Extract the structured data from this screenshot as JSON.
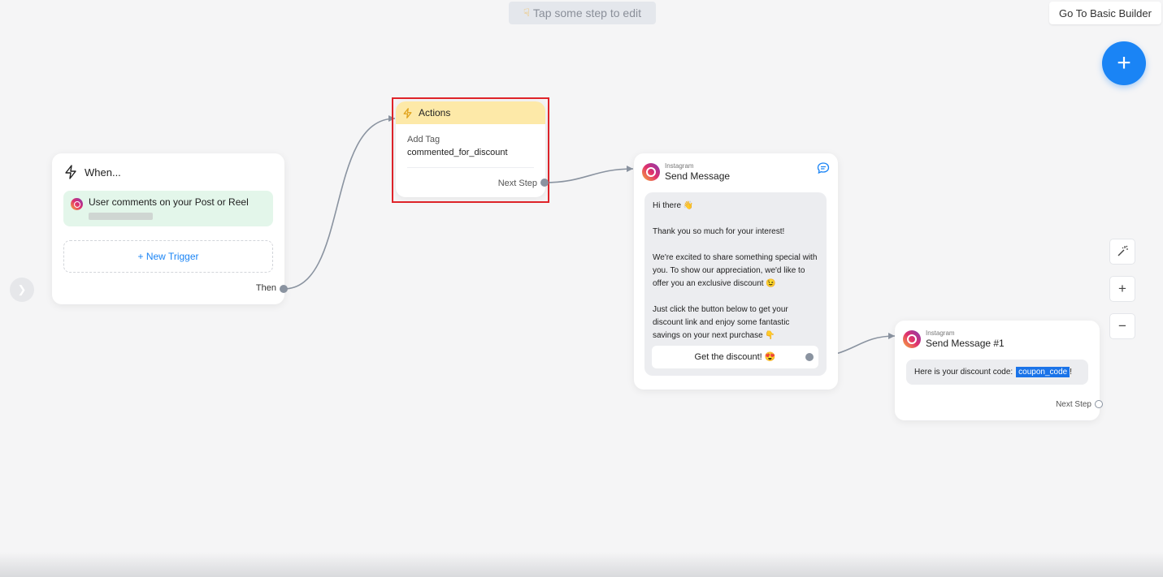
{
  "hint": {
    "icon": "pointing-down-hand-icon",
    "text": "Tap some step to edit"
  },
  "toolbar": {
    "basic_builder_label": "Go To Basic Builder",
    "add_label": "+",
    "zoom_in": "+",
    "zoom_out": "−"
  },
  "when_card": {
    "title": "When...",
    "trigger_text": "User comments on your Post or Reel",
    "new_trigger_label": "+ New Trigger",
    "then_label": "Then"
  },
  "actions_card": {
    "title": "Actions",
    "action_label": "Add Tag",
    "tag_value": "commented_for_discount",
    "next_step_label": "Next Step"
  },
  "message_card": {
    "channel": "Instagram",
    "title": "Send Message",
    "lines": [
      "Hi there 👋",
      "Thank you so much for your interest!",
      "We're excited to share something special with you. To show our appreciation, we'd like to offer you an exclusive discount 😉",
      "Just click the button below to get your discount link and enjoy some fantastic savings on your next purchase 👇"
    ],
    "button_label": "Get the discount! 😍"
  },
  "message2_card": {
    "channel": "Instagram",
    "title": "Send Message #1",
    "text": "Here is your discount code:",
    "variable": "coupon_code",
    "suffix": "!",
    "next_step_label": "Next Step"
  },
  "colors": {
    "accent": "#1a84f5",
    "highlight": "#e0242a",
    "trigger_bg": "#e3f6ea",
    "actions_header": "#fde9a8"
  }
}
